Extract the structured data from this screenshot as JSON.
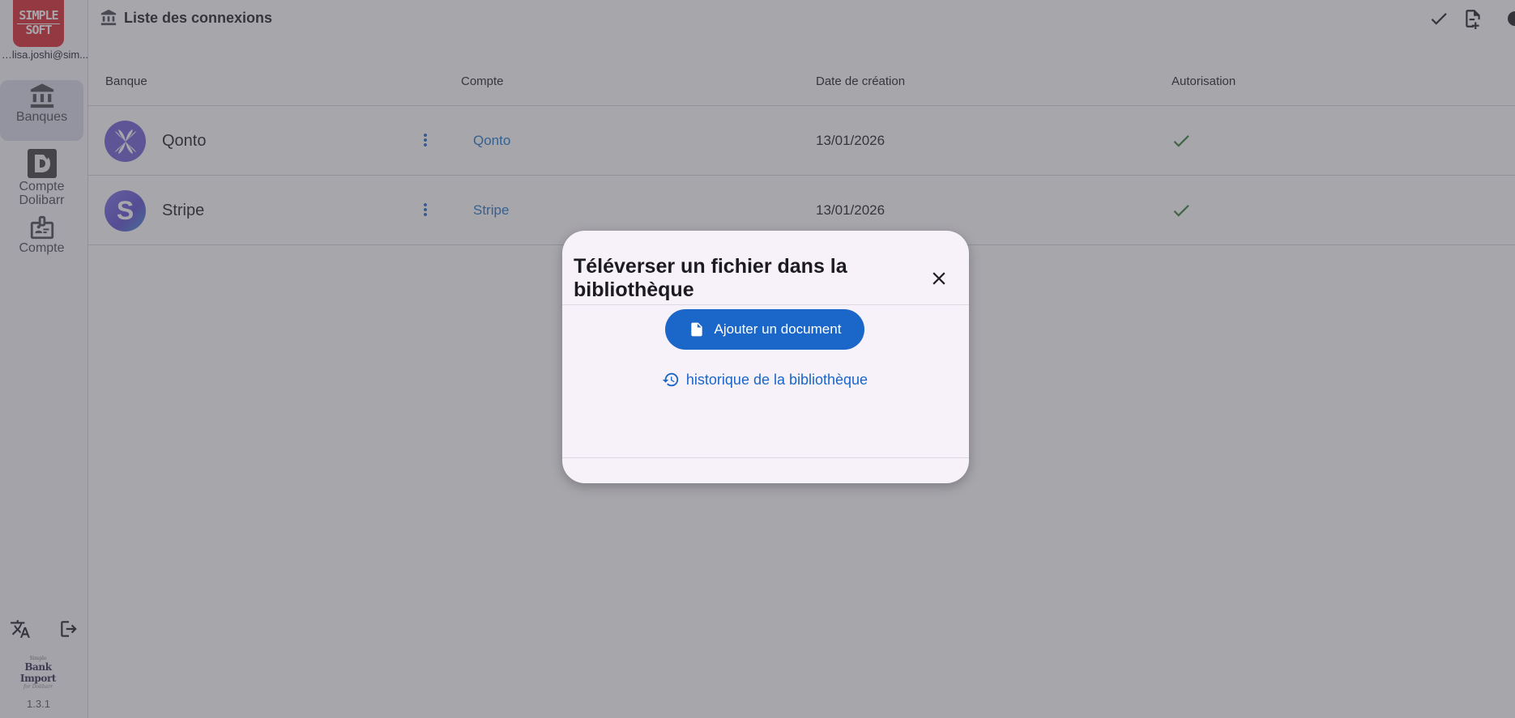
{
  "sidebar": {
    "logo": {
      "line1": "SIMPLE",
      "line2": "SOFT"
    },
    "user_email": "sonalisa.joshi@sim...",
    "items": [
      {
        "label": "Banques",
        "icon": "bank-icon",
        "active": true
      },
      {
        "label": "Compte Dolibarr",
        "line1": "Compte",
        "line2": "Dolibarr",
        "icon": "dolibarr-icon",
        "active": false
      },
      {
        "label": "Compte",
        "icon": "badge-icon",
        "active": false
      }
    ],
    "bottom_icons": [
      "translate-icon",
      "logout-icon"
    ],
    "brand": {
      "line1": "Simple",
      "line2": "Bank Import",
      "line3": "for Dolibarr"
    },
    "version": "1.3.1"
  },
  "header": {
    "title": "Liste des connexions",
    "icons": [
      "bank-icon",
      "check-icon",
      "file-add-icon"
    ]
  },
  "table": {
    "columns": [
      "Banque",
      "Compte",
      "Date de création",
      "Autorisation"
    ],
    "rows": [
      {
        "bank": "Qonto",
        "account": "Qonto",
        "date": "13/01/2026",
        "authorized": true
      },
      {
        "bank": "Stripe",
        "logo_letter": "S",
        "account": "Stripe",
        "date": "13/01/2026",
        "authorized": true
      }
    ]
  },
  "dialog": {
    "title": "Téléverser un fichier dans la bibliothèque",
    "add_button": "Ajouter un document",
    "history_link": "historique de la bibliothèque"
  },
  "colors": {
    "accent": "#1a66c9",
    "link": "#1a73c8",
    "success": "#2e7d32",
    "logo_red": "#d9232d",
    "qonto": "#6b5dd3"
  }
}
